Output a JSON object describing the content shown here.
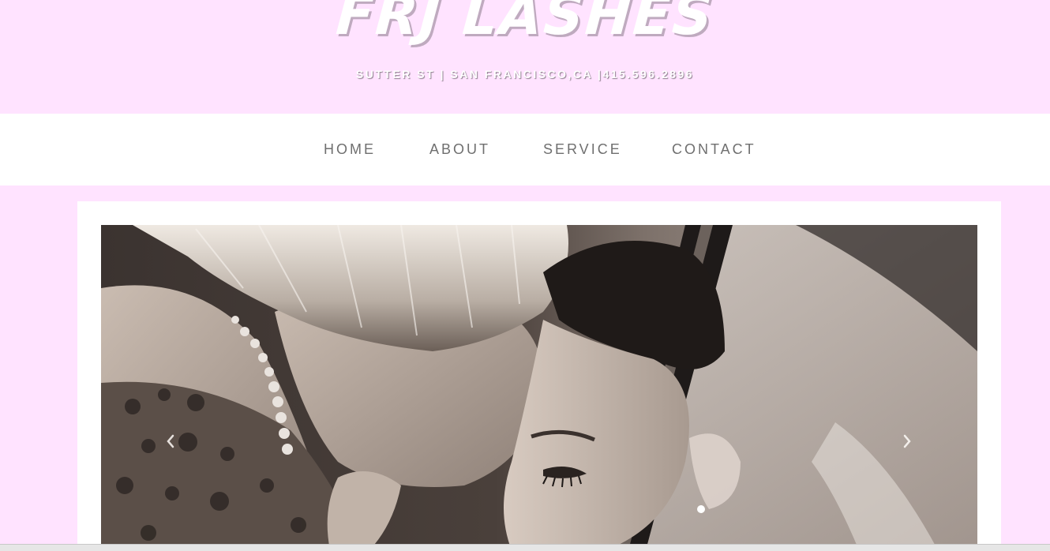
{
  "header": {
    "logo_text": "FRJ LASHES",
    "tagline": "SUTTER ST | SAN FRANCISCO,CA |415.596.2896",
    "background_color": "#ffe3ff"
  },
  "nav": {
    "items": [
      {
        "label": "HOME"
      },
      {
        "label": "ABOUT"
      },
      {
        "label": "SERVICE"
      },
      {
        "label": "CONTACT"
      }
    ],
    "text_color": "#6f6f6f"
  },
  "slideshow": {
    "image_name": "black-and-white-bridal-photo",
    "prev_icon": "chevron-left-icon",
    "next_icon": "chevron-right-icon"
  }
}
